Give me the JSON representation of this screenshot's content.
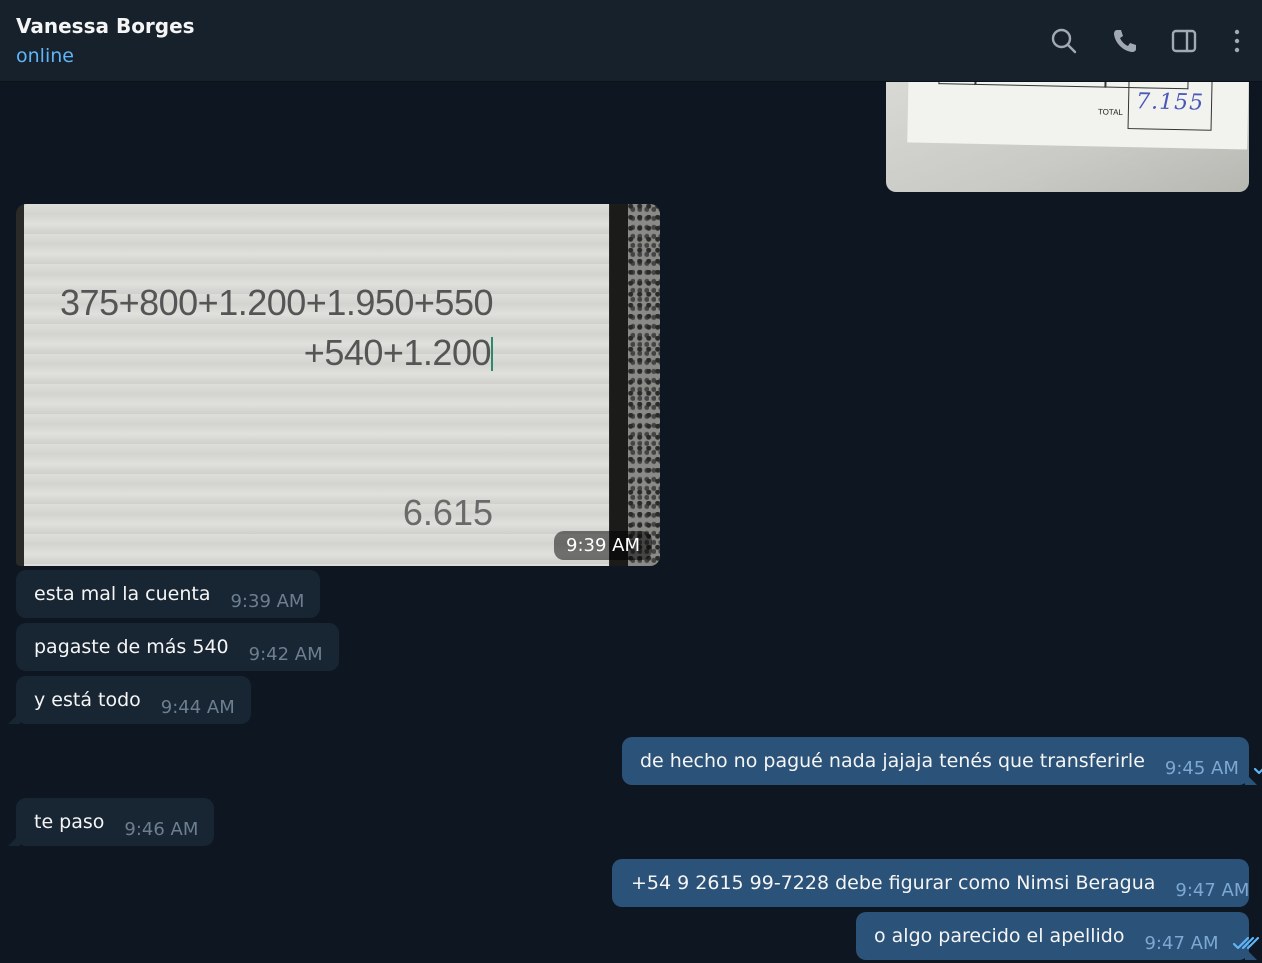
{
  "header": {
    "contact_name": "Vanessa Borges",
    "status": "online"
  },
  "photo_top": {
    "total_label": "TOTAL",
    "total_value": "7.155"
  },
  "photo_in": {
    "expression_line1": "375+800+1.200+1.950+550",
    "expression_line2": "+540+1.200",
    "result": "6.615",
    "time": "9:39 AM"
  },
  "messages": [
    {
      "text": "esta mal la cuenta",
      "time": "9:39 AM",
      "direction": "in"
    },
    {
      "text": "pagaste de más 540",
      "time": "9:42 AM",
      "direction": "in"
    },
    {
      "text": "y está todo",
      "time": "9:44 AM",
      "direction": "in"
    },
    {
      "text": "de hecho no pagué nada jajaja tenés que transferirle",
      "time": "9:45 AM",
      "direction": "out"
    },
    {
      "text": "te paso",
      "time": "9:46 AM",
      "direction": "in"
    },
    {
      "text": "+54 9 2615 99-7228 debe figurar como Nimsi Beragua",
      "time": "9:47 AM",
      "direction": "out"
    },
    {
      "text": "o algo parecido el apellido",
      "time": "9:47 AM",
      "direction": "out"
    }
  ],
  "icons": {
    "search": "search-icon",
    "call": "phone-icon",
    "sidebar": "sidebar-toggle-icon",
    "more": "more-vertical-icon",
    "read": "double-check-icon"
  },
  "colors": {
    "background": "#0e1621",
    "header": "#17212b",
    "incoming_bubble": "#182533",
    "outgoing_bubble": "#2b5278",
    "accent": "#5eb5f7"
  }
}
